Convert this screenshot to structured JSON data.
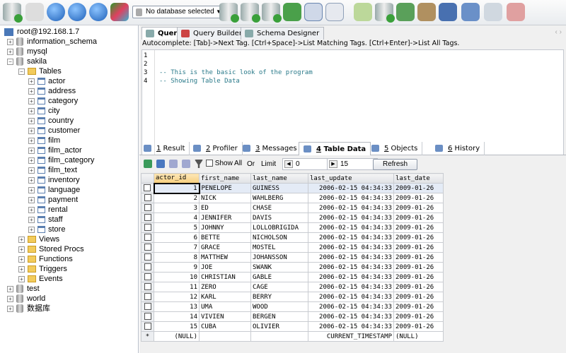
{
  "toolbar": {
    "database_select": "No database selected"
  },
  "tree": {
    "connection": "root@192.168.1.7",
    "databases_before": [
      "information_schema",
      "mysql"
    ],
    "open_db": "sakila",
    "tables_folder": "Tables",
    "tables": [
      "actor",
      "address",
      "category",
      "city",
      "country",
      "customer",
      "film",
      "film_actor",
      "film_category",
      "film_text",
      "inventory",
      "language",
      "payment",
      "rental",
      "staff",
      "store"
    ],
    "folders": [
      "Views",
      "Stored Procs",
      "Functions",
      "Triggers",
      "Events"
    ],
    "databases_after": [
      "test",
      "world",
      "数据库"
    ]
  },
  "query_tabs": [
    {
      "label": "Query"
    },
    {
      "label": "Query Builder"
    },
    {
      "label": "Schema Designer"
    }
  ],
  "autocomplete": "Autocomplete: [Tab]->Next Tag. [Ctrl+Space]->List Matching Tags. [Ctrl+Enter]->List All Tags.",
  "editor": {
    "line_numbers": [
      "1",
      "2",
      "3",
      "4"
    ],
    "lines": [
      "",
      "",
      "-- This is the basic look of the program",
      "-- Showing Table Data"
    ]
  },
  "result_tabs": [
    {
      "num": "1",
      "label": " Result"
    },
    {
      "num": "2",
      "label": " Profiler"
    },
    {
      "num": "3",
      "label": " Messages"
    },
    {
      "num": "4",
      "label": " Table Data"
    },
    {
      "num": "5",
      "label": " Objects"
    },
    {
      "num": "6",
      "label": " History"
    }
  ],
  "grid_toolbar": {
    "show_all": "Show All",
    "or": "Or",
    "limit": "Limit",
    "offset": "0",
    "count": "15",
    "refresh": "Refresh"
  },
  "grid": {
    "columns": [
      "actor_id",
      "first_name",
      "last_name",
      "last_update",
      "last_date"
    ],
    "rows": [
      [
        "1",
        "PENELOPE",
        "GUINESS",
        "2006-02-15 04:34:33",
        "2009-01-26"
      ],
      [
        "2",
        "NICK",
        "WAHLBERG",
        "2006-02-15 04:34:33",
        "2009-01-26"
      ],
      [
        "3",
        "ED",
        "CHASE",
        "2006-02-15 04:34:33",
        "2009-01-26"
      ],
      [
        "4",
        "JENNIFER",
        "DAVIS",
        "2006-02-15 04:34:33",
        "2009-01-26"
      ],
      [
        "5",
        "JOHNNY",
        "LOLLOBRIGIDA",
        "2006-02-15 04:34:33",
        "2009-01-26"
      ],
      [
        "6",
        "BETTE",
        "NICHOLSON",
        "2006-02-15 04:34:33",
        "2009-01-26"
      ],
      [
        "7",
        "GRACE",
        "MOSTEL",
        "2006-02-15 04:34:33",
        "2009-01-26"
      ],
      [
        "8",
        "MATTHEW",
        "JOHANSSON",
        "2006-02-15 04:34:33",
        "2009-01-26"
      ],
      [
        "9",
        "JOE",
        "SWANK",
        "2006-02-15 04:34:33",
        "2009-01-26"
      ],
      [
        "10",
        "CHRISTIAN",
        "GABLE",
        "2006-02-15 04:34:33",
        "2009-01-26"
      ],
      [
        "11",
        "ZERO",
        "CAGE",
        "2006-02-15 04:34:33",
        "2009-01-26"
      ],
      [
        "12",
        "KARL",
        "BERRY",
        "2006-02-15 04:34:33",
        "2009-01-26"
      ],
      [
        "13",
        "UMA",
        "WOOD",
        "2006-02-15 04:34:33",
        "2009-01-26"
      ],
      [
        "14",
        "VIVIEN",
        "BERGEN",
        "2006-02-15 04:34:33",
        "2009-01-26"
      ],
      [
        "15",
        "CUBA",
        "OLIVIER",
        "2006-02-15 04:34:33",
        "2009-01-26"
      ]
    ],
    "new_row": {
      "marker": "*",
      "actor_id": "(NULL)",
      "first_name": "",
      "last_name": "",
      "last_update": "CURRENT_TIMESTAMP",
      "last_date": "(NULL)"
    }
  }
}
